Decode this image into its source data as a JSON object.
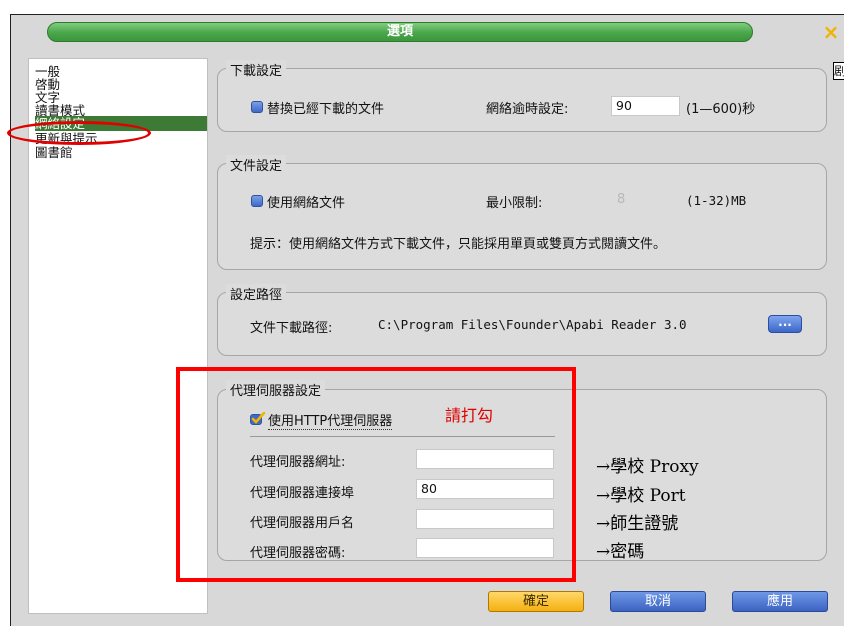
{
  "window": {
    "title": "選項",
    "close_glyph": "×",
    "edge_fragment": "剧"
  },
  "sidebar": {
    "items": [
      {
        "label": "一般"
      },
      {
        "label": "啓動"
      },
      {
        "label": "文字"
      },
      {
        "label": "讀書模式"
      },
      {
        "label": "網絡設定"
      },
      {
        "label": "更新與提示"
      },
      {
        "label": "圖書館"
      }
    ],
    "selected": "網絡設定"
  },
  "download": {
    "title": "下載設定",
    "replace_label": "替換已經下載的文件",
    "timeout_label": "網絡逾時設定:",
    "timeout_value": "90",
    "timeout_unit": "(1—600)秒"
  },
  "file": {
    "title": "文件設定",
    "use_net_label": "使用網絡文件",
    "min_label": "最小限制:",
    "min_value": "8",
    "min_unit": "(1-32)MB",
    "hint": "提示：使用網絡文件方式下載文件，只能採用單頁或雙頁方式閱讀文件。"
  },
  "path": {
    "title": "設定路徑",
    "label": "文件下載路徑:",
    "value": "C:\\Program Files\\Founder\\Apabi Reader 3.0",
    "browse_label": "..."
  },
  "proxy": {
    "title": "代理伺服器設定",
    "use_label": "使用HTTP代理伺服器",
    "check_note": "請打勾",
    "fields": [
      {
        "label": "代理伺服器網址:",
        "value": "",
        "note": "→學校 Proxy"
      },
      {
        "label": "代理伺服器連接埠",
        "value": "80",
        "note": "→學校 Port"
      },
      {
        "label": "代理伺服器用戶名",
        "value": "",
        "note": "→師生證號"
      },
      {
        "label": "代理伺服器密碼:",
        "value": "",
        "note": "→密碼"
      }
    ]
  },
  "buttons": {
    "ok": "確定",
    "cancel": "取消",
    "apply": "應用"
  },
  "colors": {
    "title_green": "#4aa64a",
    "selection_green": "#3d7a36",
    "annotation_red": "#ff0000",
    "ok_yellow": "#f4b010",
    "button_blue": "#3c63c2"
  }
}
